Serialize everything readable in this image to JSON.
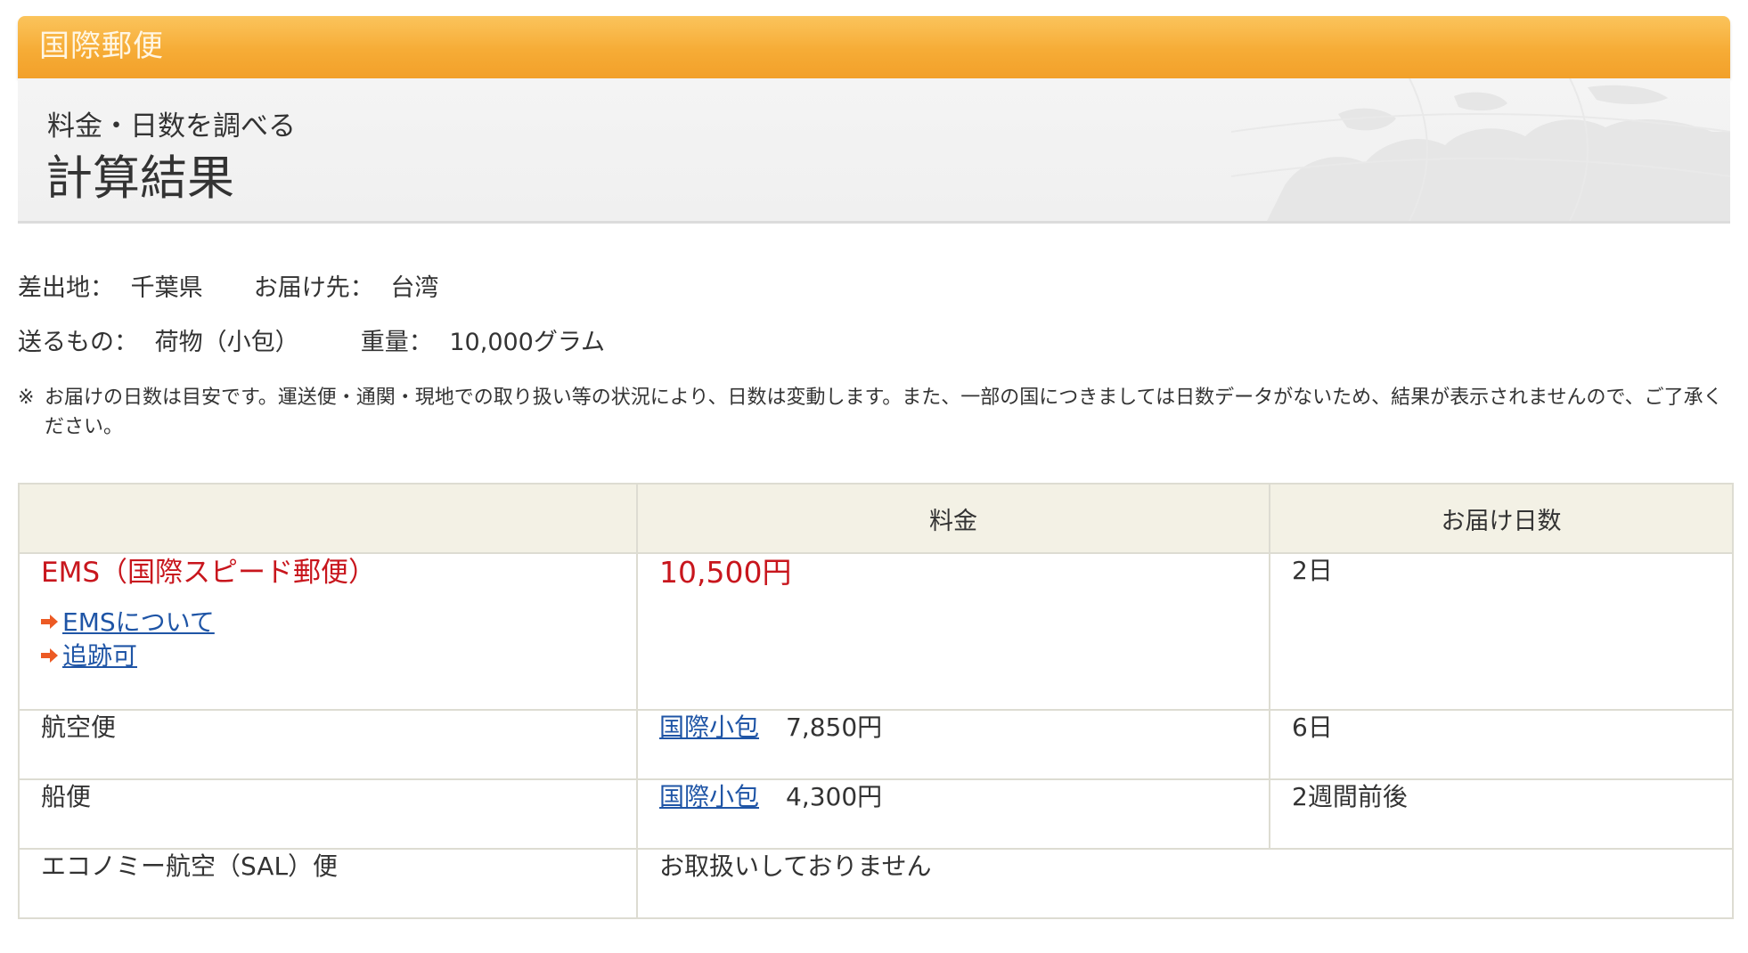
{
  "header": {
    "section_title": "国際郵便",
    "subtitle": "料金・日数を調べる",
    "title": "計算結果"
  },
  "summary": {
    "origin_label": "差出地：",
    "origin_value": "千葉県",
    "destination_label": "お届け先：",
    "destination_value": "台湾",
    "item_label": "送るもの：",
    "item_value": "荷物（小包）",
    "weight_label": "重量：",
    "weight_value": "10,000グラム"
  },
  "notice": {
    "mark": "※",
    "text": "お届けの日数は目安です。運送便・通関・現地での取り扱い等の状況により、日数は変動します。また、一部の国につきましては日数データがないため、結果が表示されませんので、ご了承ください。"
  },
  "table": {
    "headers": [
      "",
      "料金",
      "お届け日数"
    ],
    "ems": {
      "name": "EMS（国際スピード郵便）",
      "links": [
        "EMSについて",
        "追跡可"
      ],
      "fee": "10,500円",
      "days": "2日"
    },
    "rows": [
      {
        "service": "航空便",
        "fee_link": "国際小包",
        "fee": "7,850円",
        "days": "6日"
      },
      {
        "service": "船便",
        "fee_link": "国際小包",
        "fee": "4,300円",
        "days": "2週間前後"
      }
    ],
    "sal": {
      "service": "エコノミー航空（SAL）便",
      "status": "お取扱いしておりません"
    }
  },
  "colors": {
    "accent_orange": "#f6ac36",
    "ems_red": "#c8161d",
    "link_blue": "#1f55a6",
    "arrow_orange": "#ec5a24",
    "table_header_bg": "#f3f1e5"
  },
  "icons": {
    "link_arrow": "arrow-right-icon",
    "background_map": "world-map-icon"
  }
}
